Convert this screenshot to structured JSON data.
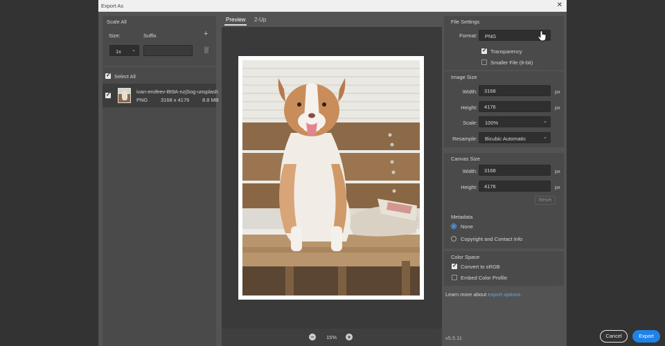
{
  "window": {
    "title": "Export As",
    "close_glyph": "✕"
  },
  "scale_panel": {
    "title": "Scale All",
    "size_label": "Size:",
    "suffix_label": "Suffix",
    "add_glyph": "+",
    "scale_value": "1x",
    "suffix_value": ""
  },
  "files_panel": {
    "select_all_label": "Select All",
    "select_all_checked": true,
    "file": {
      "name": "ivan-erofeev-Bt9A-nzjSog-unsplash",
      "format": "PNG",
      "dimensions": "3168 x 4176",
      "size": "8.8 MB",
      "checked": true
    }
  },
  "preview": {
    "tabs": [
      {
        "label": "Preview",
        "active": true
      },
      {
        "label": "2-Up",
        "active": false
      }
    ],
    "zoom": "15%",
    "zoom_out_glyph": "−",
    "zoom_in_glyph": "+"
  },
  "file_settings": {
    "title": "File Settings",
    "format_label": "Format:",
    "format_value": "PNG",
    "transparency_label": "Transparency",
    "transparency_checked": true,
    "smaller_file_label": "Smaller File (8-bit)",
    "smaller_file_checked": false
  },
  "image_size": {
    "title": "Image Size",
    "width_label": "Width:",
    "width_value": "3168",
    "height_label": "Height:",
    "height_value": "4176",
    "unit": "px",
    "scale_label": "Scale:",
    "scale_value": "100%",
    "resample_label": "Resample:",
    "resample_value": "Bicubic Automatic"
  },
  "canvas_size": {
    "title": "Canvas Size",
    "width_label": "Width:",
    "width_value": "3168",
    "height_label": "Height:",
    "height_value": "4176",
    "unit": "px",
    "reset_label": "Reset"
  },
  "metadata": {
    "title": "Metadata",
    "options": [
      {
        "label": "None",
        "selected": true
      },
      {
        "label": "Copyright and Contact Info",
        "selected": false
      }
    ]
  },
  "color_space": {
    "title": "Color Space",
    "convert_label": "Convert to sRGB",
    "convert_checked": true,
    "embed_label": "Embed Color Profile",
    "embed_checked": false
  },
  "footer": {
    "learn_more_text": "Learn more about ",
    "learn_more_link": "export options.",
    "version": "v5.5.11",
    "cancel_label": "Cancel",
    "export_label": "Export"
  },
  "colors": {
    "accent": "#1e82e6",
    "link": "#5ea8ee",
    "panel": "#4a4a4a",
    "dialog": "#535353"
  }
}
